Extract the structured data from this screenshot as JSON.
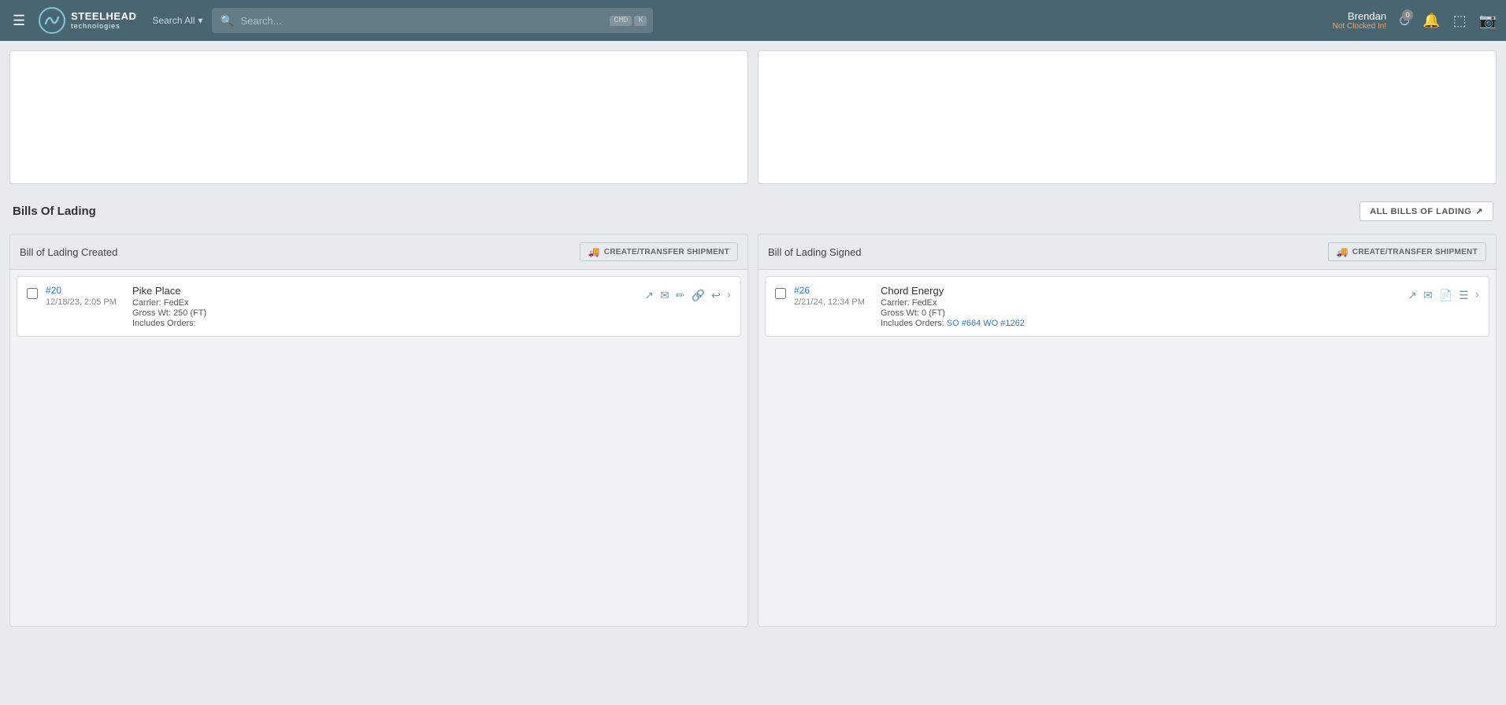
{
  "header": {
    "menu_icon": "☰",
    "logo_text": "STEELHEAD",
    "logo_sub": "technologies",
    "search_all_label": "Search All",
    "search_placeholder": "Search...",
    "kbd1": "CMD",
    "kbd2": "K",
    "user_name": "Brendan",
    "user_status": "Not Clocked In!",
    "notifications_count": "0",
    "all_bol_button": "ALL BILLS OF LADING"
  },
  "bol_section": {
    "title": "Bills Of Lading",
    "all_bol_label": "ALL BILLS OF LADING",
    "created_col": {
      "title": "Bill of Lading Created",
      "create_btn": "CREATE/TRANSFER SHIPMENT",
      "items": [
        {
          "id": "#20",
          "date": "12/18/23, 2:05 PM",
          "company": "Pike Place",
          "carrier": "Carrier: FedEx",
          "weight": "Gross Wt: 250 (FT)",
          "orders_label": "Includes Orders:",
          "orders": ""
        }
      ]
    },
    "signed_col": {
      "title": "Bill of Lading Signed",
      "create_btn": "CREATE/TRANSFER SHIPMENT",
      "items": [
        {
          "id": "#26",
          "date": "2/21/24, 12:34 PM",
          "company": "Chord Energy",
          "carrier": "Carrier: FedEx",
          "weight": "Gross Wt: 0 (FT)",
          "orders_label": "Includes Orders:",
          "orders": "SO #664  WO #1262",
          "orders_links": true
        }
      ]
    }
  }
}
